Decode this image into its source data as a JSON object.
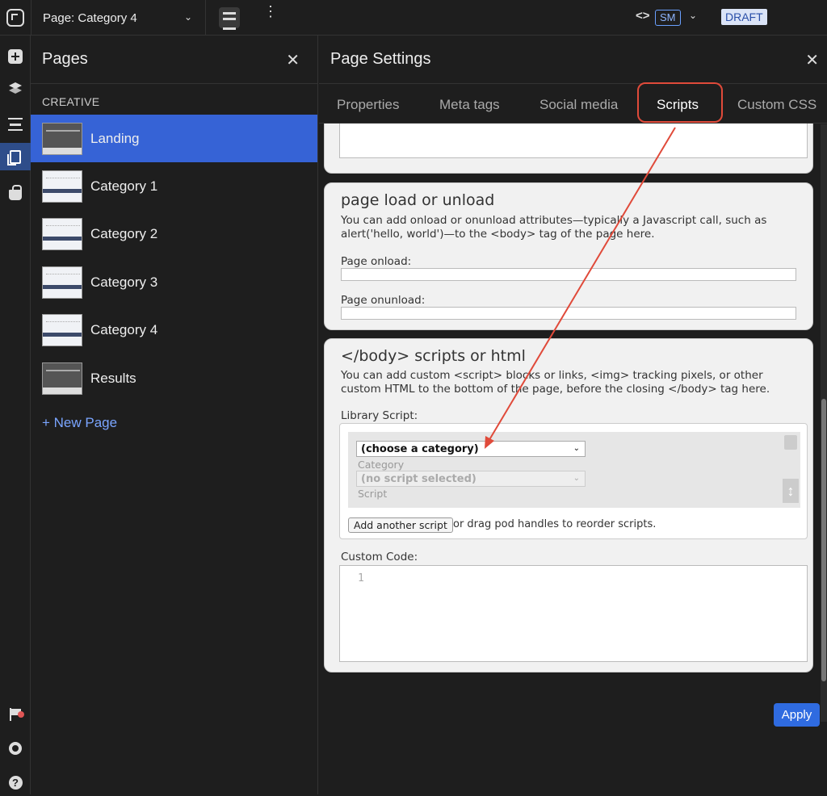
{
  "topbar": {
    "page_select": "Page: Category 4",
    "chevron": "⌄",
    "kebab": "⋮",
    "code_toggle": "<>",
    "breakpoint": "SM",
    "status": "DRAFT"
  },
  "icons": {
    "logo": "logo-icon",
    "rail": [
      "add-element-icon",
      "layers-icon",
      "sections-icon",
      "pages-icon",
      "shopping-bag-icon",
      "flag-icon",
      "gear-icon",
      "help-icon"
    ],
    "help_glyph": "?"
  },
  "pages_panel": {
    "title": "Pages",
    "close": "✕",
    "section_label": "CREATIVE",
    "pages": [
      {
        "name": "Landing",
        "active": true
      },
      {
        "name": "Category 1"
      },
      {
        "name": "Category 2"
      },
      {
        "name": "Category 3"
      },
      {
        "name": "Category 4"
      },
      {
        "name": "Results"
      }
    ],
    "new_page": "+ New Page"
  },
  "settings": {
    "title": "Page Settings",
    "close": "✕",
    "tabs": [
      "Properties",
      "Meta tags",
      "Social media",
      "Scripts",
      "Custom CSS"
    ],
    "active_tab": "Scripts",
    "onload_card": {
      "heading": "page load or unload",
      "description": "You can add onload or onunload attributes—typically a Javascript call, such as alert('hello, world')—to the <body> tag of the page here.",
      "onload_label": "Page onload:",
      "onunload_label": "Page onunload:"
    },
    "body_card": {
      "heading": "</body> scripts or html",
      "description": "You can add custom <script> blocks or links, <img> tracking pixels, or other custom HTML to the bottom of the page, before the closing </body> tag here.",
      "library_label": "Library Script:",
      "category_select": "(choose a category)",
      "category_label": "Category",
      "script_select": "(no script selected)",
      "script_label": "Script",
      "select_chevron": "⌄",
      "updown": "↕",
      "add_button": "Add another script",
      "add_tail": "or drag pod handles to reorder scripts.",
      "custom_code_label": "Custom Code:",
      "line_number": "1"
    },
    "apply": "Apply"
  },
  "colors": {
    "accent": "#3663d6",
    "annotation": "#e04a3a",
    "apply": "#2f6be0"
  }
}
